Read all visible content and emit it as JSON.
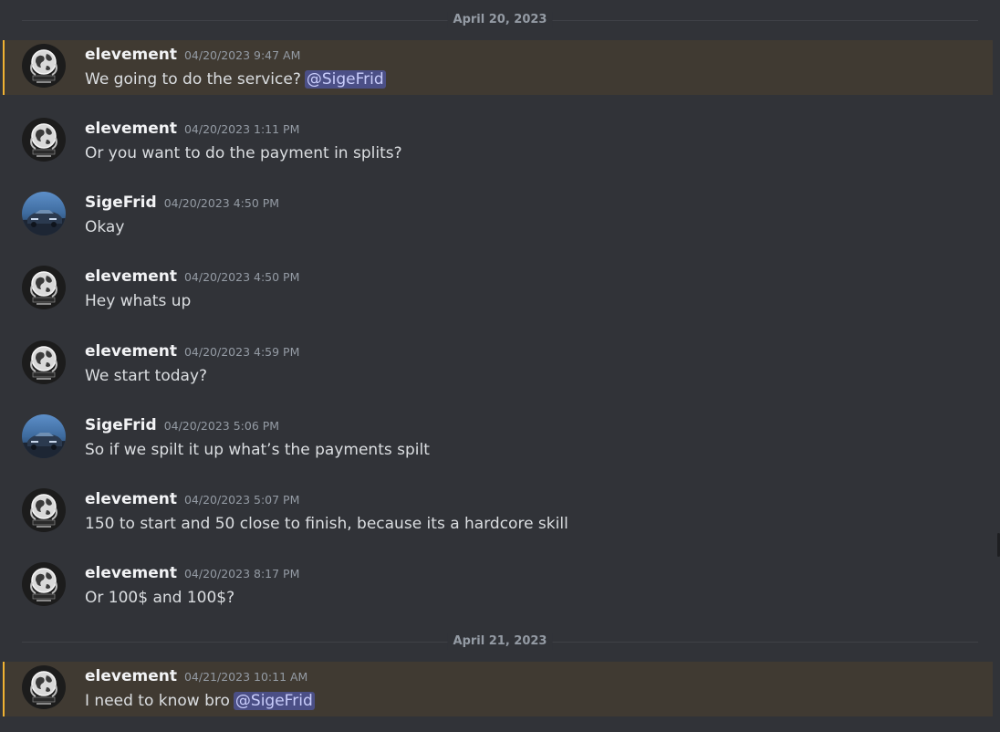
{
  "dates": {
    "first": "April 20, 2023",
    "second": "April 21, 2023"
  },
  "messages": [
    {
      "author": "elevement",
      "timestamp": "04/20/2023 9:47 AM",
      "text": "We going to do the service?",
      "mention": "@SigeFrid",
      "avatar": "elevement-globe-avatar"
    },
    {
      "author": "elevement",
      "timestamp": "04/20/2023 1:11 PM",
      "text": "Or you want to do the payment in splits?",
      "avatar": "elevement-globe-avatar"
    },
    {
      "author": "SigeFrid",
      "timestamp": "04/20/2023 4:50 PM",
      "text": "Okay",
      "avatar": "sigefrid-car-avatar"
    },
    {
      "author": "elevement",
      "timestamp": "04/20/2023 4:50 PM",
      "text": "Hey whats up",
      "avatar": "elevement-globe-avatar"
    },
    {
      "author": "elevement",
      "timestamp": "04/20/2023 4:59 PM",
      "text": "We start today?",
      "avatar": "elevement-globe-avatar"
    },
    {
      "author": "SigeFrid",
      "timestamp": "04/20/2023 5:06 PM",
      "text": "So if we spilt it up what’s the payments spilt",
      "avatar": "sigefrid-car-avatar"
    },
    {
      "author": "elevement",
      "timestamp": "04/20/2023 5:07 PM",
      "text": "150 to start and 50 close to finish, because its a hardcore skill",
      "avatar": "elevement-globe-avatar"
    },
    {
      "author": "elevement",
      "timestamp": "04/20/2023 8:17 PM",
      "text": "Or 100$ and 100$?",
      "avatar": "elevement-globe-avatar"
    },
    {
      "author": "elevement",
      "timestamp": "04/21/2023 10:11 AM",
      "text": "I need to know bro",
      "mention": "@SigeFrid",
      "avatar": "elevement-globe-avatar"
    }
  ],
  "colors": {
    "background": "#313338",
    "mention_highlight": "#403a32",
    "mention_bar": "#f0b232",
    "mention_pill": "#4b4f86",
    "username": "#f2f3f5",
    "timestamp": "#949ba4"
  }
}
